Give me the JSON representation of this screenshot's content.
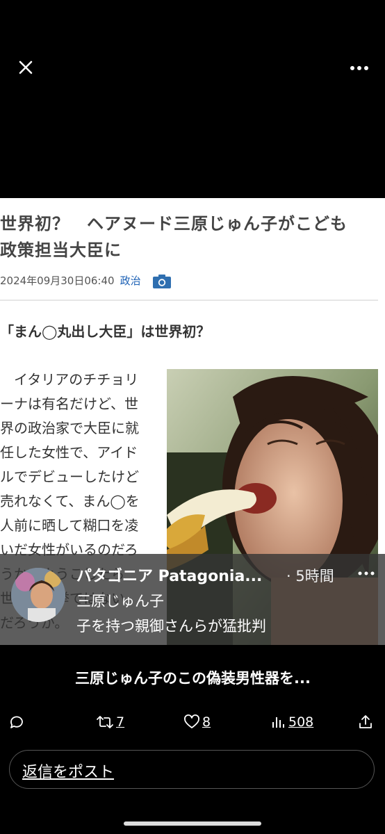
{
  "article": {
    "headline_line1": "世界初？　ヘアヌード三原じゅん子がこども",
    "headline_line2": "政策担当大臣に",
    "date": "2024年09月30日06:40",
    "category": "政治",
    "subheading": "「まん◯丸出し大臣」は世界初？",
    "body": "　イタリアのチチョリ\nーナは有名だけど、世\n界の政治家で大臣に就\n任した女性で、アイド\nルでデビューしたけど\n売れなくて、まん◯を\n人前に晒して糊口を凌\nいだ女性がいるのだろ\nうか。ようこしたら\n世界で快挙ではない\nだろうか。"
  },
  "notification": {
    "title": "パタゴニア Patagonia...",
    "time": "· 5時間",
    "line1": "三原じゅん子",
    "line2": "子を持つ親御さんらが猛批判"
  },
  "caption": "三原じゅん子のこの偽装男性器を...",
  "actions": {
    "retweets": "7",
    "likes": "8",
    "views": "508"
  },
  "reply_placeholder": "返信をポスト",
  "colors": {
    "background": "#000000",
    "article_bg": "#ffffff",
    "category_link": "#1a5fb4",
    "notification_overlay": "#343434"
  }
}
